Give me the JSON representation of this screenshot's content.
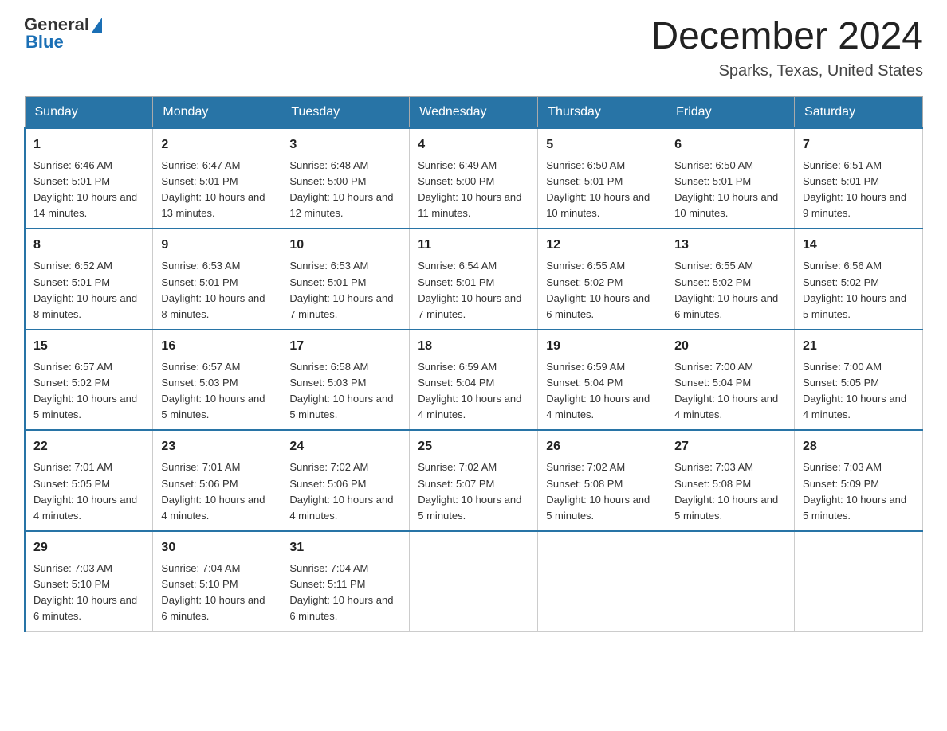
{
  "header": {
    "logo_general": "General",
    "logo_blue": "Blue",
    "title": "December 2024",
    "subtitle": "Sparks, Texas, United States"
  },
  "days_of_week": [
    "Sunday",
    "Monday",
    "Tuesday",
    "Wednesday",
    "Thursday",
    "Friday",
    "Saturday"
  ],
  "weeks": [
    [
      {
        "day": "1",
        "sunrise": "6:46 AM",
        "sunset": "5:01 PM",
        "daylight": "10 hours and 14 minutes."
      },
      {
        "day": "2",
        "sunrise": "6:47 AM",
        "sunset": "5:01 PM",
        "daylight": "10 hours and 13 minutes."
      },
      {
        "day": "3",
        "sunrise": "6:48 AM",
        "sunset": "5:00 PM",
        "daylight": "10 hours and 12 minutes."
      },
      {
        "day": "4",
        "sunrise": "6:49 AM",
        "sunset": "5:00 PM",
        "daylight": "10 hours and 11 minutes."
      },
      {
        "day": "5",
        "sunrise": "6:50 AM",
        "sunset": "5:01 PM",
        "daylight": "10 hours and 10 minutes."
      },
      {
        "day": "6",
        "sunrise": "6:50 AM",
        "sunset": "5:01 PM",
        "daylight": "10 hours and 10 minutes."
      },
      {
        "day": "7",
        "sunrise": "6:51 AM",
        "sunset": "5:01 PM",
        "daylight": "10 hours and 9 minutes."
      }
    ],
    [
      {
        "day": "8",
        "sunrise": "6:52 AM",
        "sunset": "5:01 PM",
        "daylight": "10 hours and 8 minutes."
      },
      {
        "day": "9",
        "sunrise": "6:53 AM",
        "sunset": "5:01 PM",
        "daylight": "10 hours and 8 minutes."
      },
      {
        "day": "10",
        "sunrise": "6:53 AM",
        "sunset": "5:01 PM",
        "daylight": "10 hours and 7 minutes."
      },
      {
        "day": "11",
        "sunrise": "6:54 AM",
        "sunset": "5:01 PM",
        "daylight": "10 hours and 7 minutes."
      },
      {
        "day": "12",
        "sunrise": "6:55 AM",
        "sunset": "5:02 PM",
        "daylight": "10 hours and 6 minutes."
      },
      {
        "day": "13",
        "sunrise": "6:55 AM",
        "sunset": "5:02 PM",
        "daylight": "10 hours and 6 minutes."
      },
      {
        "day": "14",
        "sunrise": "6:56 AM",
        "sunset": "5:02 PM",
        "daylight": "10 hours and 5 minutes."
      }
    ],
    [
      {
        "day": "15",
        "sunrise": "6:57 AM",
        "sunset": "5:02 PM",
        "daylight": "10 hours and 5 minutes."
      },
      {
        "day": "16",
        "sunrise": "6:57 AM",
        "sunset": "5:03 PM",
        "daylight": "10 hours and 5 minutes."
      },
      {
        "day": "17",
        "sunrise": "6:58 AM",
        "sunset": "5:03 PM",
        "daylight": "10 hours and 5 minutes."
      },
      {
        "day": "18",
        "sunrise": "6:59 AM",
        "sunset": "5:04 PM",
        "daylight": "10 hours and 4 minutes."
      },
      {
        "day": "19",
        "sunrise": "6:59 AM",
        "sunset": "5:04 PM",
        "daylight": "10 hours and 4 minutes."
      },
      {
        "day": "20",
        "sunrise": "7:00 AM",
        "sunset": "5:04 PM",
        "daylight": "10 hours and 4 minutes."
      },
      {
        "day": "21",
        "sunrise": "7:00 AM",
        "sunset": "5:05 PM",
        "daylight": "10 hours and 4 minutes."
      }
    ],
    [
      {
        "day": "22",
        "sunrise": "7:01 AM",
        "sunset": "5:05 PM",
        "daylight": "10 hours and 4 minutes."
      },
      {
        "day": "23",
        "sunrise": "7:01 AM",
        "sunset": "5:06 PM",
        "daylight": "10 hours and 4 minutes."
      },
      {
        "day": "24",
        "sunrise": "7:02 AM",
        "sunset": "5:06 PM",
        "daylight": "10 hours and 4 minutes."
      },
      {
        "day": "25",
        "sunrise": "7:02 AM",
        "sunset": "5:07 PM",
        "daylight": "10 hours and 5 minutes."
      },
      {
        "day": "26",
        "sunrise": "7:02 AM",
        "sunset": "5:08 PM",
        "daylight": "10 hours and 5 minutes."
      },
      {
        "day": "27",
        "sunrise": "7:03 AM",
        "sunset": "5:08 PM",
        "daylight": "10 hours and 5 minutes."
      },
      {
        "day": "28",
        "sunrise": "7:03 AM",
        "sunset": "5:09 PM",
        "daylight": "10 hours and 5 minutes."
      }
    ],
    [
      {
        "day": "29",
        "sunrise": "7:03 AM",
        "sunset": "5:10 PM",
        "daylight": "10 hours and 6 minutes."
      },
      {
        "day": "30",
        "sunrise": "7:04 AM",
        "sunset": "5:10 PM",
        "daylight": "10 hours and 6 minutes."
      },
      {
        "day": "31",
        "sunrise": "7:04 AM",
        "sunset": "5:11 PM",
        "daylight": "10 hours and 6 minutes."
      },
      null,
      null,
      null,
      null
    ]
  ]
}
